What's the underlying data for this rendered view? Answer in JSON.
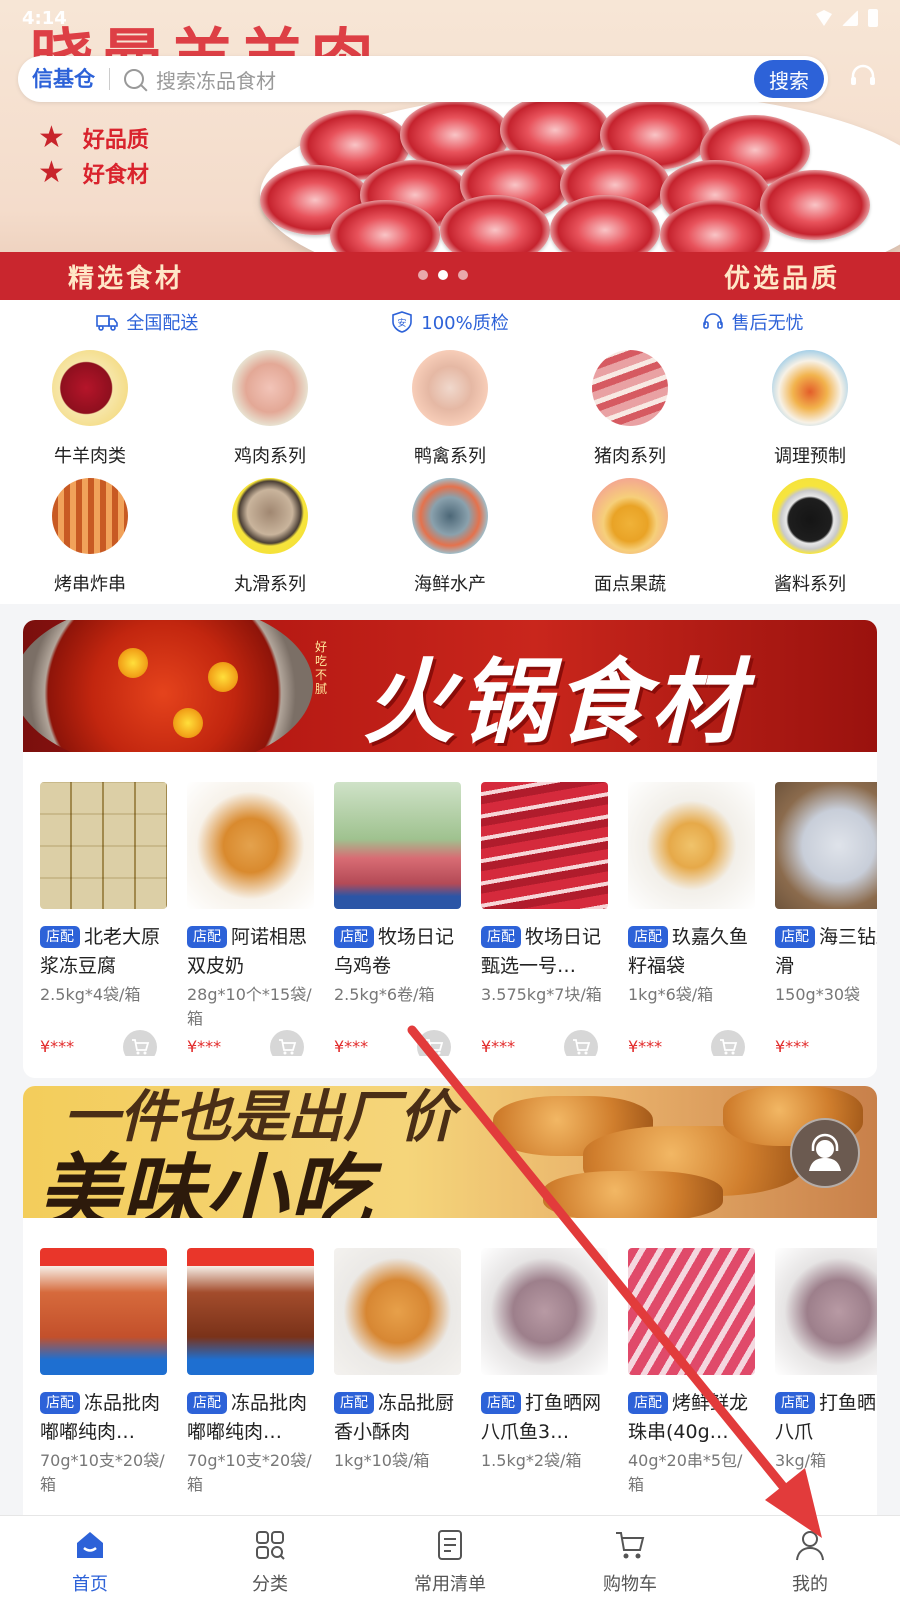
{
  "status_bar": {
    "time": "4:14"
  },
  "banner": {
    "title": "晓曼羊羊肉",
    "bullets": [
      "好品质",
      "好食材"
    ],
    "strip_left": "精选食材",
    "strip_right": "优选品质"
  },
  "search": {
    "store_name": "信基仓",
    "placeholder": "搜索冻品食材",
    "button_label": "搜索"
  },
  "services": [
    {
      "label": "全国配送",
      "icon": "truck-icon"
    },
    {
      "label": "100%质检",
      "icon": "shield-icon"
    },
    {
      "label": "售后无忧",
      "icon": "headset-icon"
    }
  ],
  "categories": [
    {
      "label": "牛羊肉类"
    },
    {
      "label": "鸡肉系列"
    },
    {
      "label": "鸭禽系列"
    },
    {
      "label": "猪肉系列"
    },
    {
      "label": "调理预制"
    },
    {
      "label": "烤串炸串"
    },
    {
      "label": "丸滑系列"
    },
    {
      "label": "海鲜水产"
    },
    {
      "label": "面点果蔬"
    },
    {
      "label": "酱料系列"
    }
  ],
  "hotpot": {
    "banner_title": "火锅食材",
    "banner_side": "好吃不腻",
    "products": [
      {
        "tag": "店配",
        "name": "北老大原浆冻豆腐",
        "spec": "2.5kg*4袋/箱",
        "price": "¥***"
      },
      {
        "tag": "店配",
        "name": "阿诺相思双皮奶",
        "spec": "28g*10个*15袋/箱",
        "price": "¥***"
      },
      {
        "tag": "店配",
        "name": "牧场日记乌鸡卷",
        "spec": "2.5kg*6卷/箱",
        "price": "¥***"
      },
      {
        "tag": "店配",
        "name": "牧场日记甄选一号…",
        "spec": "3.575kg*7块/箱",
        "price": "¥***"
      },
      {
        "tag": "店配",
        "name": "玖嘉久鱼籽福袋",
        "spec": "1kg*6袋/箱",
        "price": "¥***"
      },
      {
        "tag": "店配",
        "name": "海三钻虾滑",
        "spec": "150g*30袋",
        "price": "¥***"
      }
    ]
  },
  "snack": {
    "banner_line1": "一件也是出厂价",
    "banner_line2": "美味小吃",
    "products": [
      {
        "tag": "店配",
        "name": "冻品批肉嘟嘟纯肉…",
        "spec": "70g*10支*20袋/箱"
      },
      {
        "tag": "店配",
        "name": "冻品批肉嘟嘟纯肉…",
        "spec": "70g*10支*20袋/箱"
      },
      {
        "tag": "店配",
        "name": "冻品批厨香小酥肉",
        "spec": "1kg*10袋/箱"
      },
      {
        "tag": "店配",
        "name": "打鱼晒网八爪鱼3…",
        "spec": "1.5kg*2袋/箱"
      },
      {
        "tag": "店配",
        "name": "烤鲜鲜龙珠串(40g…",
        "spec": "40g*20串*5包/箱"
      },
      {
        "tag": "店配",
        "name": "打鱼晒网八爪",
        "spec": "3kg/箱"
      }
    ]
  },
  "bottom_nav": [
    {
      "label": "首页",
      "icon": "home-icon",
      "active": true
    },
    {
      "label": "分类",
      "icon": "category-icon",
      "active": false
    },
    {
      "label": "常用清单",
      "icon": "list-icon",
      "active": false
    },
    {
      "label": "购物车",
      "icon": "cart-icon",
      "active": false
    },
    {
      "label": "我的",
      "icon": "profile-icon",
      "active": false
    }
  ],
  "colors": {
    "brand": "#2d62d8",
    "price": "#e22b2b",
    "banner_red": "#c9262e",
    "annotation_arrow": "#e23b3b"
  }
}
